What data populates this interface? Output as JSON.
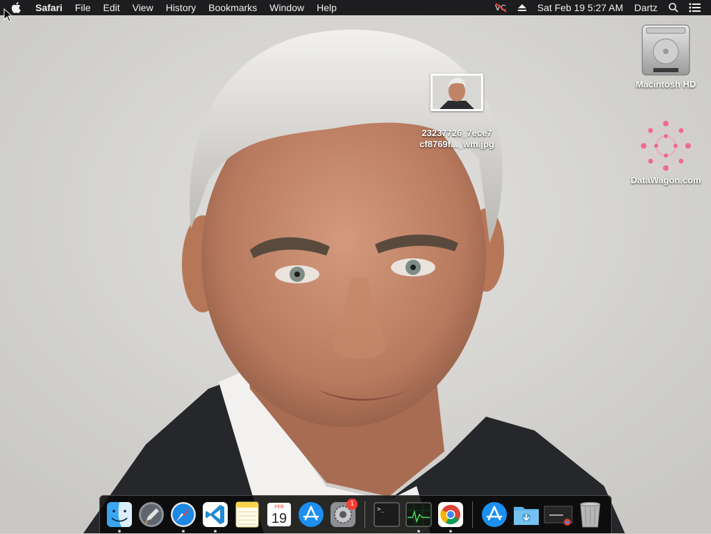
{
  "menubar": {
    "app_name": "Safari",
    "menus": [
      "File",
      "Edit",
      "View",
      "History",
      "Bookmarks",
      "Window",
      "Help"
    ],
    "datetime": "Sat Feb 19  5:27 AM",
    "user": "Dartz",
    "status_icons": [
      "vnc-icon",
      "eject-icon",
      "search-icon",
      "list-icon"
    ]
  },
  "desktop": {
    "icons": [
      {
        "label": "Macintosh HD",
        "icon": "hard-drive-icon"
      },
      {
        "label": "DataWagon.com",
        "icon": "datawagon-logo-icon"
      }
    ],
    "file": {
      "label_line1": "23237726_7ece7",
      "label_line2": "cf8769f..._wm.jpg"
    }
  },
  "dock": {
    "items": [
      {
        "name": "finder",
        "running": true
      },
      {
        "name": "launchpad",
        "running": false
      },
      {
        "name": "safari",
        "running": true
      },
      {
        "name": "vscode",
        "running": true
      },
      {
        "name": "notes",
        "running": false
      },
      {
        "name": "calendar",
        "running": false,
        "month": "FEB",
        "day": "19"
      },
      {
        "name": "app-store",
        "running": false
      },
      {
        "name": "system-preferences",
        "running": false,
        "badge": "1"
      },
      {
        "name": "terminal",
        "running": false
      },
      {
        "name": "activity-monitor",
        "running": true
      },
      {
        "name": "chrome",
        "running": true
      },
      {
        "name": "app-store-folder",
        "running": false
      },
      {
        "name": "downloads-folder",
        "running": false
      },
      {
        "name": "chrome-window",
        "running": false
      },
      {
        "name": "trash",
        "running": false
      }
    ]
  },
  "colors": {
    "menubar_bg": "#1d1d1f",
    "dock_bg": "#0a0a0a",
    "badge": "#ff3b30",
    "wallpaper_bg": "#d3d2cf"
  }
}
